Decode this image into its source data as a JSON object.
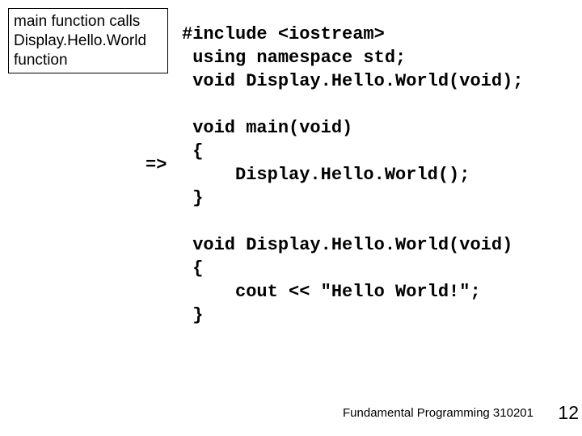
{
  "annotation": "main function calls Display.Hello.World function",
  "code": {
    "line1": "#include <iostream>",
    "line2": " using namespace std;",
    "line3": " void Display.Hello.World(void);",
    "line4": "",
    "line5": " void main(void)",
    "line6": " {",
    "line7": "     Display.Hello.World();",
    "line8": " }",
    "line9": "",
    "line10": " void Display.Hello.World(void)",
    "line11": " {",
    "line12": "     cout << \"Hello World!\";",
    "line13": " }"
  },
  "pointer": "=>",
  "footer": "Fundamental Programming 310201",
  "page": "12"
}
